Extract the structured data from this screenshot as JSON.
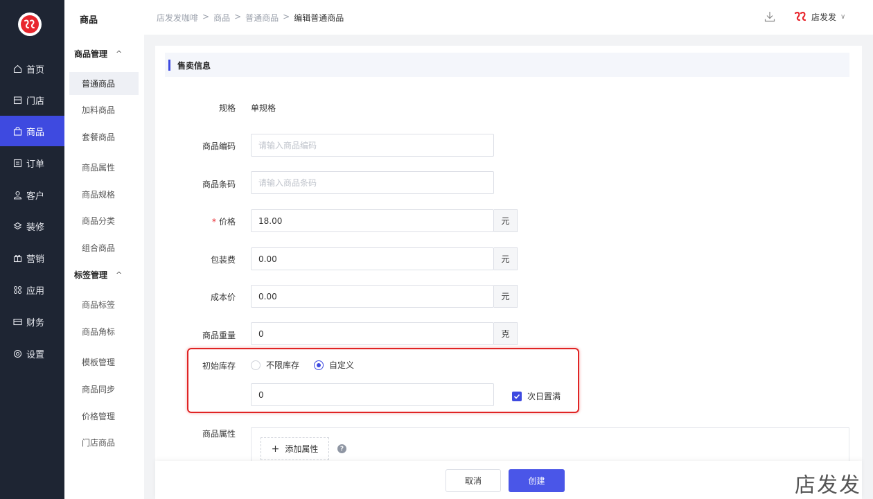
{
  "nav": {
    "logo_text": "ЪЪ",
    "items": [
      {
        "label": "首页",
        "icon": "home-icon"
      },
      {
        "label": "门店",
        "icon": "store-icon"
      },
      {
        "label": "商品",
        "icon": "bag-icon",
        "active": true
      },
      {
        "label": "订单",
        "icon": "order-icon"
      },
      {
        "label": "客户",
        "icon": "user-icon"
      },
      {
        "label": "装修",
        "icon": "layers-icon"
      },
      {
        "label": "营销",
        "icon": "gift-icon"
      },
      {
        "label": "应用",
        "icon": "apps-icon"
      },
      {
        "label": "财务",
        "icon": "card-icon"
      },
      {
        "label": "设置",
        "icon": "settings-icon"
      }
    ]
  },
  "submenu": {
    "title": "商品",
    "group1": "商品管理",
    "group1_items": [
      "普通商品",
      "加料商品",
      "套餐商品",
      "商品属性",
      "商品规格",
      "商品分类",
      "组合商品"
    ],
    "group2": "标签管理",
    "group2_items": [
      "商品标签",
      "商品角标"
    ],
    "bottom_items": [
      "模板管理",
      "商品同步",
      "价格管理",
      "门店商品"
    ]
  },
  "header": {
    "breadcrumb": [
      "店发发咖啡",
      "商品",
      "普通商品",
      "编辑普通商品"
    ],
    "separator": ">",
    "user_name": "店发发"
  },
  "form": {
    "section_title": "售卖信息",
    "spec_label": "规格",
    "spec_value": "单规格",
    "code_label": "商品编码",
    "code_placeholder": "请输入商品编码",
    "barcode_label": "商品条码",
    "barcode_placeholder": "请输入商品条码",
    "price_required": "*",
    "price_label": "价格",
    "price_value": "18.00",
    "price_unit": "元",
    "packing_label": "包装费",
    "packing_value": "0.00",
    "packing_unit": "元",
    "cost_label": "成本价",
    "cost_value": "0.00",
    "cost_unit": "元",
    "weight_label": "商品重量",
    "weight_value": "0",
    "weight_unit": "克",
    "stock_label": "初始库存",
    "stock_option_unlimited": "不限库存",
    "stock_option_custom": "自定义",
    "stock_selected": "自定义",
    "stock_value": "0",
    "refill_label": "次日置满",
    "refill_checked": true,
    "attr_label": "商品属性",
    "add_attr_label": "添加属性",
    "help_glyph": "?"
  },
  "footer": {
    "cancel_label": "取消",
    "create_label": "创建"
  },
  "watermark": "店发发",
  "colors": {
    "primary": "#3e4ae0",
    "sidebar_bg": "#1e2533",
    "highlight": "#e02424",
    "brand_red": "#e8262d"
  }
}
